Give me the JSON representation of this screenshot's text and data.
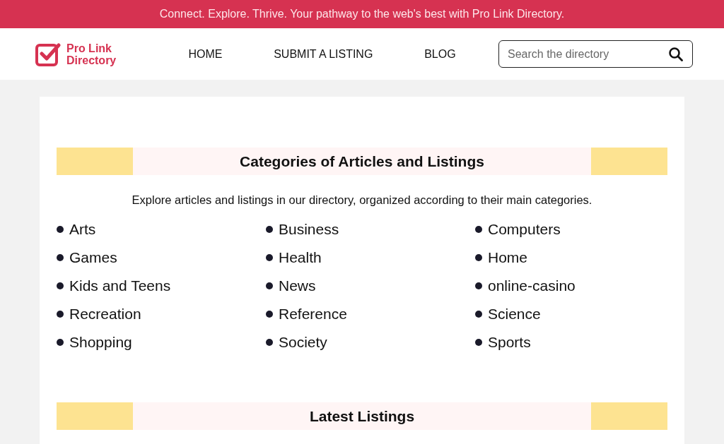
{
  "announcement": "Connect. Explore. Thrive. Your pathway to the web's best with Pro Link Directory.",
  "logo": {
    "line_1": "Pro Link",
    "line_2": "Directory"
  },
  "nav": [
    {
      "label": "HOME"
    },
    {
      "label": "SUBMIT A LISTING"
    },
    {
      "label": "BLOG"
    }
  ],
  "search": {
    "placeholder": "Search the directory"
  },
  "categories_section": {
    "title": "Categories of Articles and Listings",
    "description": "Explore articles and listings in our directory, organized according to their main categories.",
    "items": [
      "Arts",
      "Business",
      "Computers",
      "Games",
      "Health",
      "Home",
      "Kids and Teens",
      "News",
      "online-casino",
      "Recreation",
      "Reference",
      "Science",
      "Shopping",
      "Society",
      "Sports"
    ]
  },
  "latest_section": {
    "title": "Latest Listings"
  }
}
